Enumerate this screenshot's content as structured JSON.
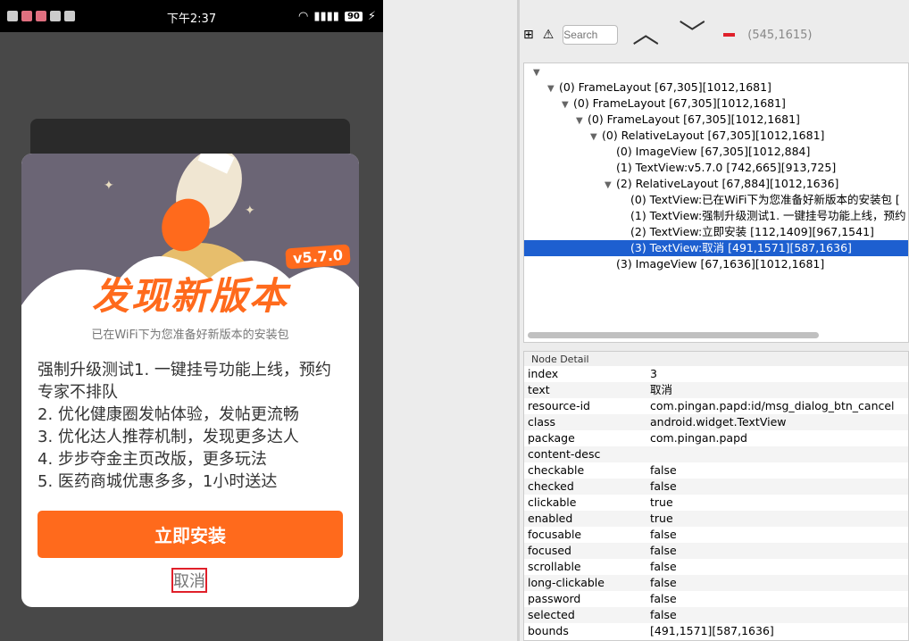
{
  "phone": {
    "status": {
      "time": "下午2:37",
      "battery": "90"
    },
    "dialog": {
      "version": "v5.7.0",
      "title": "发现新版本",
      "subtitle": "已在WiFi下为您准备好新版本的安装包",
      "notes": [
        "强制升级测试1. 一键挂号功能上线，预约专家不排队",
        "2. 优化健康圈发帖体验，发帖更流畅",
        "3. 优化达人推荐机制，发现更多达人",
        "4. 步步夺金主页改版，更多玩法",
        "5. 医药商城优惠多多，1小时送达"
      ],
      "install_label": "立即安装",
      "cancel_label": "取消"
    }
  },
  "inspector": {
    "search_placeholder": "Search",
    "coordinate": "(545,1615)",
    "tree": [
      {
        "text": "",
        "depth": 0,
        "expanded": true
      },
      {
        "text": "(0) FrameLayout [67,305][1012,1681]",
        "depth": 1,
        "expanded": true
      },
      {
        "text": "(0) FrameLayout [67,305][1012,1681]",
        "depth": 2,
        "expanded": true
      },
      {
        "text": "(0) FrameLayout [67,305][1012,1681]",
        "depth": 3,
        "expanded": true
      },
      {
        "text": "(0) RelativeLayout [67,305][1012,1681]",
        "depth": 4,
        "expanded": true
      },
      {
        "text": "(0) ImageView [67,305][1012,884]",
        "depth": 5,
        "expanded": null
      },
      {
        "text": "(1) TextView:v5.7.0 [742,665][913,725]",
        "depth": 5,
        "expanded": null
      },
      {
        "text": "(2) RelativeLayout [67,884][1012,1636]",
        "depth": 5,
        "expanded": true
      },
      {
        "text": "(0) TextView:已在WiFi下为您准备好新版本的安装包 [",
        "depth": 6,
        "expanded": null
      },
      {
        "text": "(1) TextView:强制升级测试1. 一键挂号功能上线，预约",
        "depth": 6,
        "expanded": null
      },
      {
        "text": "(2) TextView:立即安装 [112,1409][967,1541]",
        "depth": 6,
        "expanded": null
      },
      {
        "text": "(3) TextView:取消 [491,1571][587,1636]",
        "depth": 6,
        "expanded": null,
        "selected": true
      },
      {
        "text": "(3) ImageView [67,1636][1012,1681]",
        "depth": 5,
        "expanded": null
      }
    ],
    "detail_title": "Node Detail",
    "detail": [
      {
        "key": "index",
        "value": "3"
      },
      {
        "key": "text",
        "value": "取消"
      },
      {
        "key": "resource-id",
        "value": "com.pingan.papd:id/msg_dialog_btn_cancel"
      },
      {
        "key": "class",
        "value": "android.widget.TextView"
      },
      {
        "key": "package",
        "value": "com.pingan.papd"
      },
      {
        "key": "content-desc",
        "value": ""
      },
      {
        "key": "checkable",
        "value": "false"
      },
      {
        "key": "checked",
        "value": "false"
      },
      {
        "key": "clickable",
        "value": "true"
      },
      {
        "key": "enabled",
        "value": "true"
      },
      {
        "key": "focusable",
        "value": "false"
      },
      {
        "key": "focused",
        "value": "false"
      },
      {
        "key": "scrollable",
        "value": "false"
      },
      {
        "key": "long-clickable",
        "value": "false"
      },
      {
        "key": "password",
        "value": "false"
      },
      {
        "key": "selected",
        "value": "false"
      },
      {
        "key": "bounds",
        "value": "[491,1571][587,1636]"
      }
    ]
  },
  "colors": {
    "accent": "#ff6a1c",
    "selection": "#1d5fd0",
    "highlight": "#e0202a"
  }
}
